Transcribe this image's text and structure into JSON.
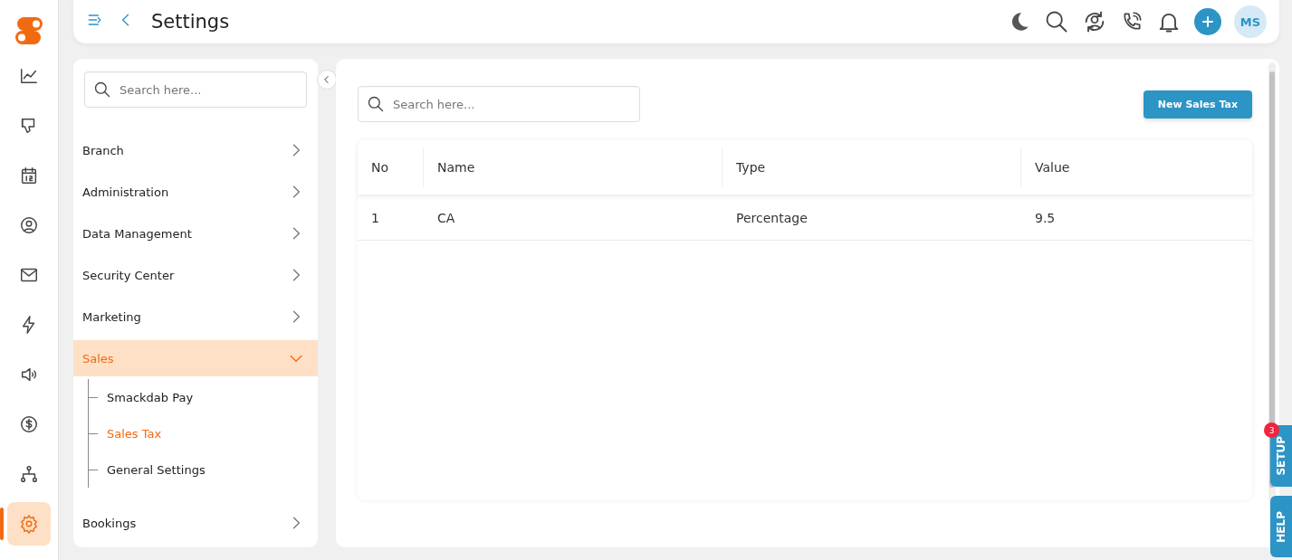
{
  "rail": {
    "items": [
      {
        "kind": "chart",
        "selected": false
      },
      {
        "kind": "thumb",
        "selected": false
      },
      {
        "kind": "calendar",
        "selected": false
      },
      {
        "kind": "user",
        "selected": false
      },
      {
        "kind": "mail",
        "selected": false
      },
      {
        "kind": "bolt",
        "selected": false
      },
      {
        "kind": "speaker",
        "selected": false
      },
      {
        "kind": "dollar",
        "selected": false
      },
      {
        "kind": "network",
        "selected": false
      },
      {
        "kind": "gear",
        "selected": true
      }
    ]
  },
  "header": {
    "title": "Settings",
    "avatar": "MS"
  },
  "settings_menu": {
    "search": {
      "placeholder": "Search here..."
    },
    "items": [
      {
        "label": "Branch",
        "expanded": false,
        "selected": false
      },
      {
        "label": "Administration",
        "expanded": false,
        "selected": false
      },
      {
        "label": "Data Management",
        "expanded": false,
        "selected": false
      },
      {
        "label": "Security Center",
        "expanded": false,
        "selected": false
      },
      {
        "label": "Marketing",
        "expanded": false,
        "selected": false
      },
      {
        "label": "Sales",
        "expanded": true,
        "selected": true,
        "children": [
          {
            "label": "Smackdab Pay",
            "selected": false
          },
          {
            "label": "Sales Tax",
            "selected": true
          },
          {
            "label": "General Settings",
            "selected": false
          }
        ]
      },
      {
        "label": "Bookings",
        "expanded": false,
        "selected": false
      }
    ]
  },
  "main": {
    "search": {
      "placeholder": "Search here..."
    },
    "new_button": "New Sales Tax",
    "table": {
      "columns": [
        "No",
        "Name",
        "Type",
        "Value"
      ],
      "rows": [
        [
          "1",
          "CA",
          "Percentage",
          "9.5"
        ]
      ]
    }
  },
  "side_tabs": [
    {
      "label": "SETUP",
      "badge": "3"
    },
    {
      "label": "HELP"
    }
  ]
}
